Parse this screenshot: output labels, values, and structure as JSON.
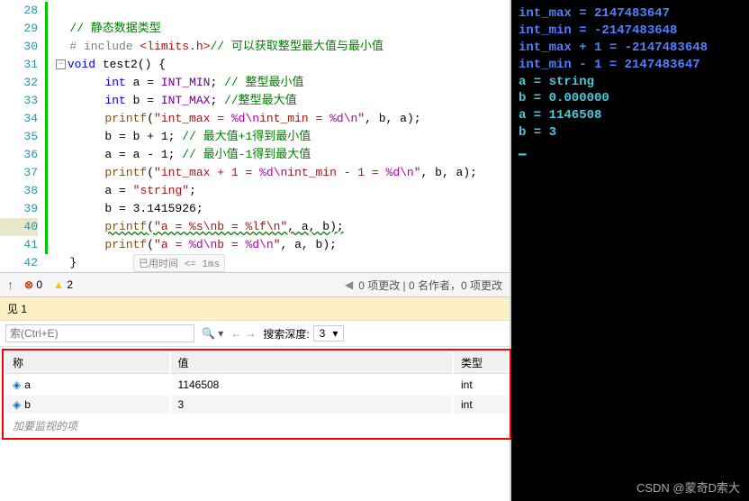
{
  "editor": {
    "lines": [
      28,
      29,
      30,
      31,
      32,
      33,
      34,
      35,
      36,
      37,
      38,
      39,
      40,
      41,
      42
    ],
    "highlighted_line": 40,
    "code": {
      "l29_comment": "// 静态数据类型",
      "l30_include": "# include ",
      "l30_header": "<limits.h>",
      "l30_comment": "// 可以获取整型最大值与最小值",
      "l31_kw1": "void",
      "l31_fn": " test2",
      "l31_rest": "() {",
      "l32_kw": "int",
      "l32_var": " a = ",
      "l32_mac": "INT_MIN",
      "l32_end": "; ",
      "l32_cm": "// 整型最小值",
      "l33_kw": "int",
      "l33_var": " b = ",
      "l33_mac": "INT_MAX",
      "l33_end": "; ",
      "l33_cm": "//整型最大值",
      "l34_fn": "printf",
      "l34_p1": "(",
      "l34_s1": "\"int_max = ",
      "l34_e1": "%d\\n",
      "l34_s2": "int_min = ",
      "l34_e2": "%d\\n",
      "l34_s3": "\"",
      "l34_end": ", b, a);",
      "l35": "b = b + 1; ",
      "l35_cm": "// 最大值+1得到最小值",
      "l36": "a = a - 1; ",
      "l36_cm": "// 最小值-1得到最大值",
      "l37_fn": "printf",
      "l37_p": "(",
      "l37_s1": "\"int_max + 1 = ",
      "l37_e1": "%d\\n",
      "l37_s2": "int_min - 1 = ",
      "l37_e2": "%d\\n",
      "l37_s3": "\"",
      "l37_end": ", b, a);",
      "l38": "a = ",
      "l38_str": "\"string\"",
      "l38_end": ";",
      "l39": "b = 3.1415926;",
      "l40_fn": "printf",
      "l40_p": "(",
      "l40_s": "\"a = %s\\nb = %lf\\n\"",
      "l40_end": ", a, b);",
      "l41_fn": "printf",
      "l41_p": "(",
      "l41_s1": "\"a = ",
      "l41_e1": "%d\\n",
      "l41_s2": "b = ",
      "l41_e2": "%d\\n",
      "l41_s3": "\"",
      "l41_end": ", a, b);",
      "l42": "}"
    },
    "timing": "已用时间 <= 1ms"
  },
  "status": {
    "errors": "0",
    "warnings": "2",
    "changes": "0 项更改 | 0 名作者，0 项更改"
  },
  "watch": {
    "title": "见 1",
    "search_placeholder": "索(Ctrl+E)",
    "depth_label": "搜索深度:",
    "depth_value": "3",
    "columns": {
      "name": "称",
      "value": "值",
      "type": "类型"
    },
    "rows": [
      {
        "name": "a",
        "value": "1146508",
        "type": "int"
      },
      {
        "name": "b",
        "value": "3",
        "type": "int"
      }
    ],
    "add_label": "加要监视的项"
  },
  "console": {
    "lines": [
      "int_max = 2147483647",
      "int_min = -2147483648",
      "int_max + 1 = -2147483648",
      "int_min - 1 = 2147483647",
      "a = string",
      "b = 0.000000",
      "a = 1146508",
      "b = 3"
    ]
  },
  "watermark": "CSDN @蒙奇D索大"
}
